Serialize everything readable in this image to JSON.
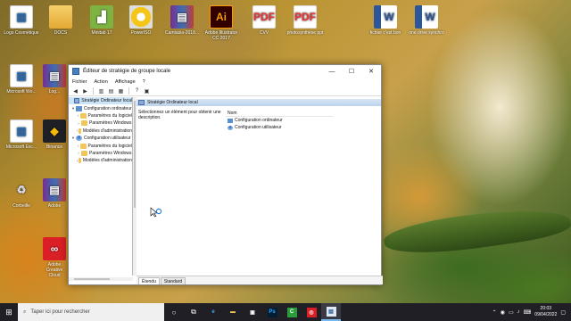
{
  "desktop": {
    "icons": [
      {
        "label": "Logo Cosmétique",
        "icon": "image-file-icon"
      },
      {
        "label": "DOCS",
        "icon": "folder-icon"
      },
      {
        "label": "Minitab 17",
        "icon": "minitab-icon"
      },
      {
        "label": "PowerISO",
        "icon": "poweriso-icon"
      },
      {
        "label": "Camtasia-2018...",
        "icon": "winrar-icon"
      },
      {
        "label": "Adobe Illustrator CC 2017",
        "icon": "illustrator-icon"
      },
      {
        "label": "CVV",
        "icon": "pdf-icon"
      },
      {
        "label": "photosynthèse ppt",
        "icon": "pdf-icon"
      },
      {
        "label": "fichier c'est bon",
        "icon": "word-icon"
      },
      {
        "label": "one drive synchro",
        "icon": "word-icon"
      },
      {
        "label": "Microsoft Wo...",
        "icon": "image-file-icon"
      },
      {
        "label": "Log...",
        "icon": "winrar-icon"
      },
      {
        "label": "Microsoft Exc...",
        "icon": "image-file-icon"
      },
      {
        "label": "Binance",
        "icon": "binance-icon"
      },
      {
        "label": "Corbeille",
        "icon": "recycle-bin-icon"
      },
      {
        "label": "Adobe",
        "icon": "winrar-icon"
      },
      {
        "label": "Adobe Creative Cloud",
        "icon": "creative-cloud-icon"
      }
    ]
  },
  "window": {
    "title": "Éditeur de stratégie de groupe locale",
    "minimize": "—",
    "maximize": "☐",
    "close": "✕",
    "menu": [
      "Fichier",
      "Action",
      "Affichage",
      "?"
    ],
    "tree": [
      {
        "label": "Stratégie Ordinateur local",
        "level": 0,
        "twisty": "",
        "icon": "policy",
        "selected": true
      },
      {
        "label": "Configuration ordinateur",
        "level": 1,
        "twisty": "▾",
        "icon": "pc"
      },
      {
        "label": "Paramètres du logiciel",
        "level": 2,
        "twisty": "›",
        "icon": "folder"
      },
      {
        "label": "Paramètres Windows",
        "level": 2,
        "twisty": "›",
        "icon": "folder"
      },
      {
        "label": "Modèles d'administration",
        "level": 2,
        "twisty": "›",
        "icon": "folder"
      },
      {
        "label": "Configuration utilisateur",
        "level": 1,
        "twisty": "▾",
        "icon": "user"
      },
      {
        "label": "Paramètres du logiciel",
        "level": 2,
        "twisty": "›",
        "icon": "folder"
      },
      {
        "label": "Paramètres Windows",
        "level": 2,
        "twisty": "›",
        "icon": "folder"
      },
      {
        "label": "Modèles d'administration",
        "level": 2,
        "twisty": "›",
        "icon": "folder"
      }
    ],
    "pane_header": "Stratégie Ordinateur local",
    "description": "Sélectionnez un élément pour obtenir une description.",
    "list_column": "Nom",
    "list_items": [
      {
        "label": "Configuration ordinateur",
        "icon": "pc"
      },
      {
        "label": "Configuration utilisateur",
        "icon": "user"
      }
    ],
    "tabs": [
      {
        "label": "Étendu",
        "active": true
      },
      {
        "label": "Standard",
        "active": false
      }
    ]
  },
  "taskbar": {
    "search_placeholder": "Taper ici pour rechercher",
    "apps": [
      {
        "name": "cortana-icon",
        "glyph": "○"
      },
      {
        "name": "task-view-icon",
        "glyph": "⧉"
      },
      {
        "name": "edge-icon",
        "glyph": "e"
      },
      {
        "name": "file-explorer-icon",
        "glyph": "▬"
      },
      {
        "name": "store-icon",
        "glyph": "▣"
      },
      {
        "name": "photoshop-icon",
        "glyph": "Ps"
      },
      {
        "name": "camtasia-icon",
        "glyph": "C"
      },
      {
        "name": "creative-cloud-icon",
        "glyph": "◎"
      },
      {
        "name": "group-policy-editor-icon",
        "glyph": "▤"
      }
    ],
    "time": "20:03",
    "date": "09/04/2022"
  }
}
